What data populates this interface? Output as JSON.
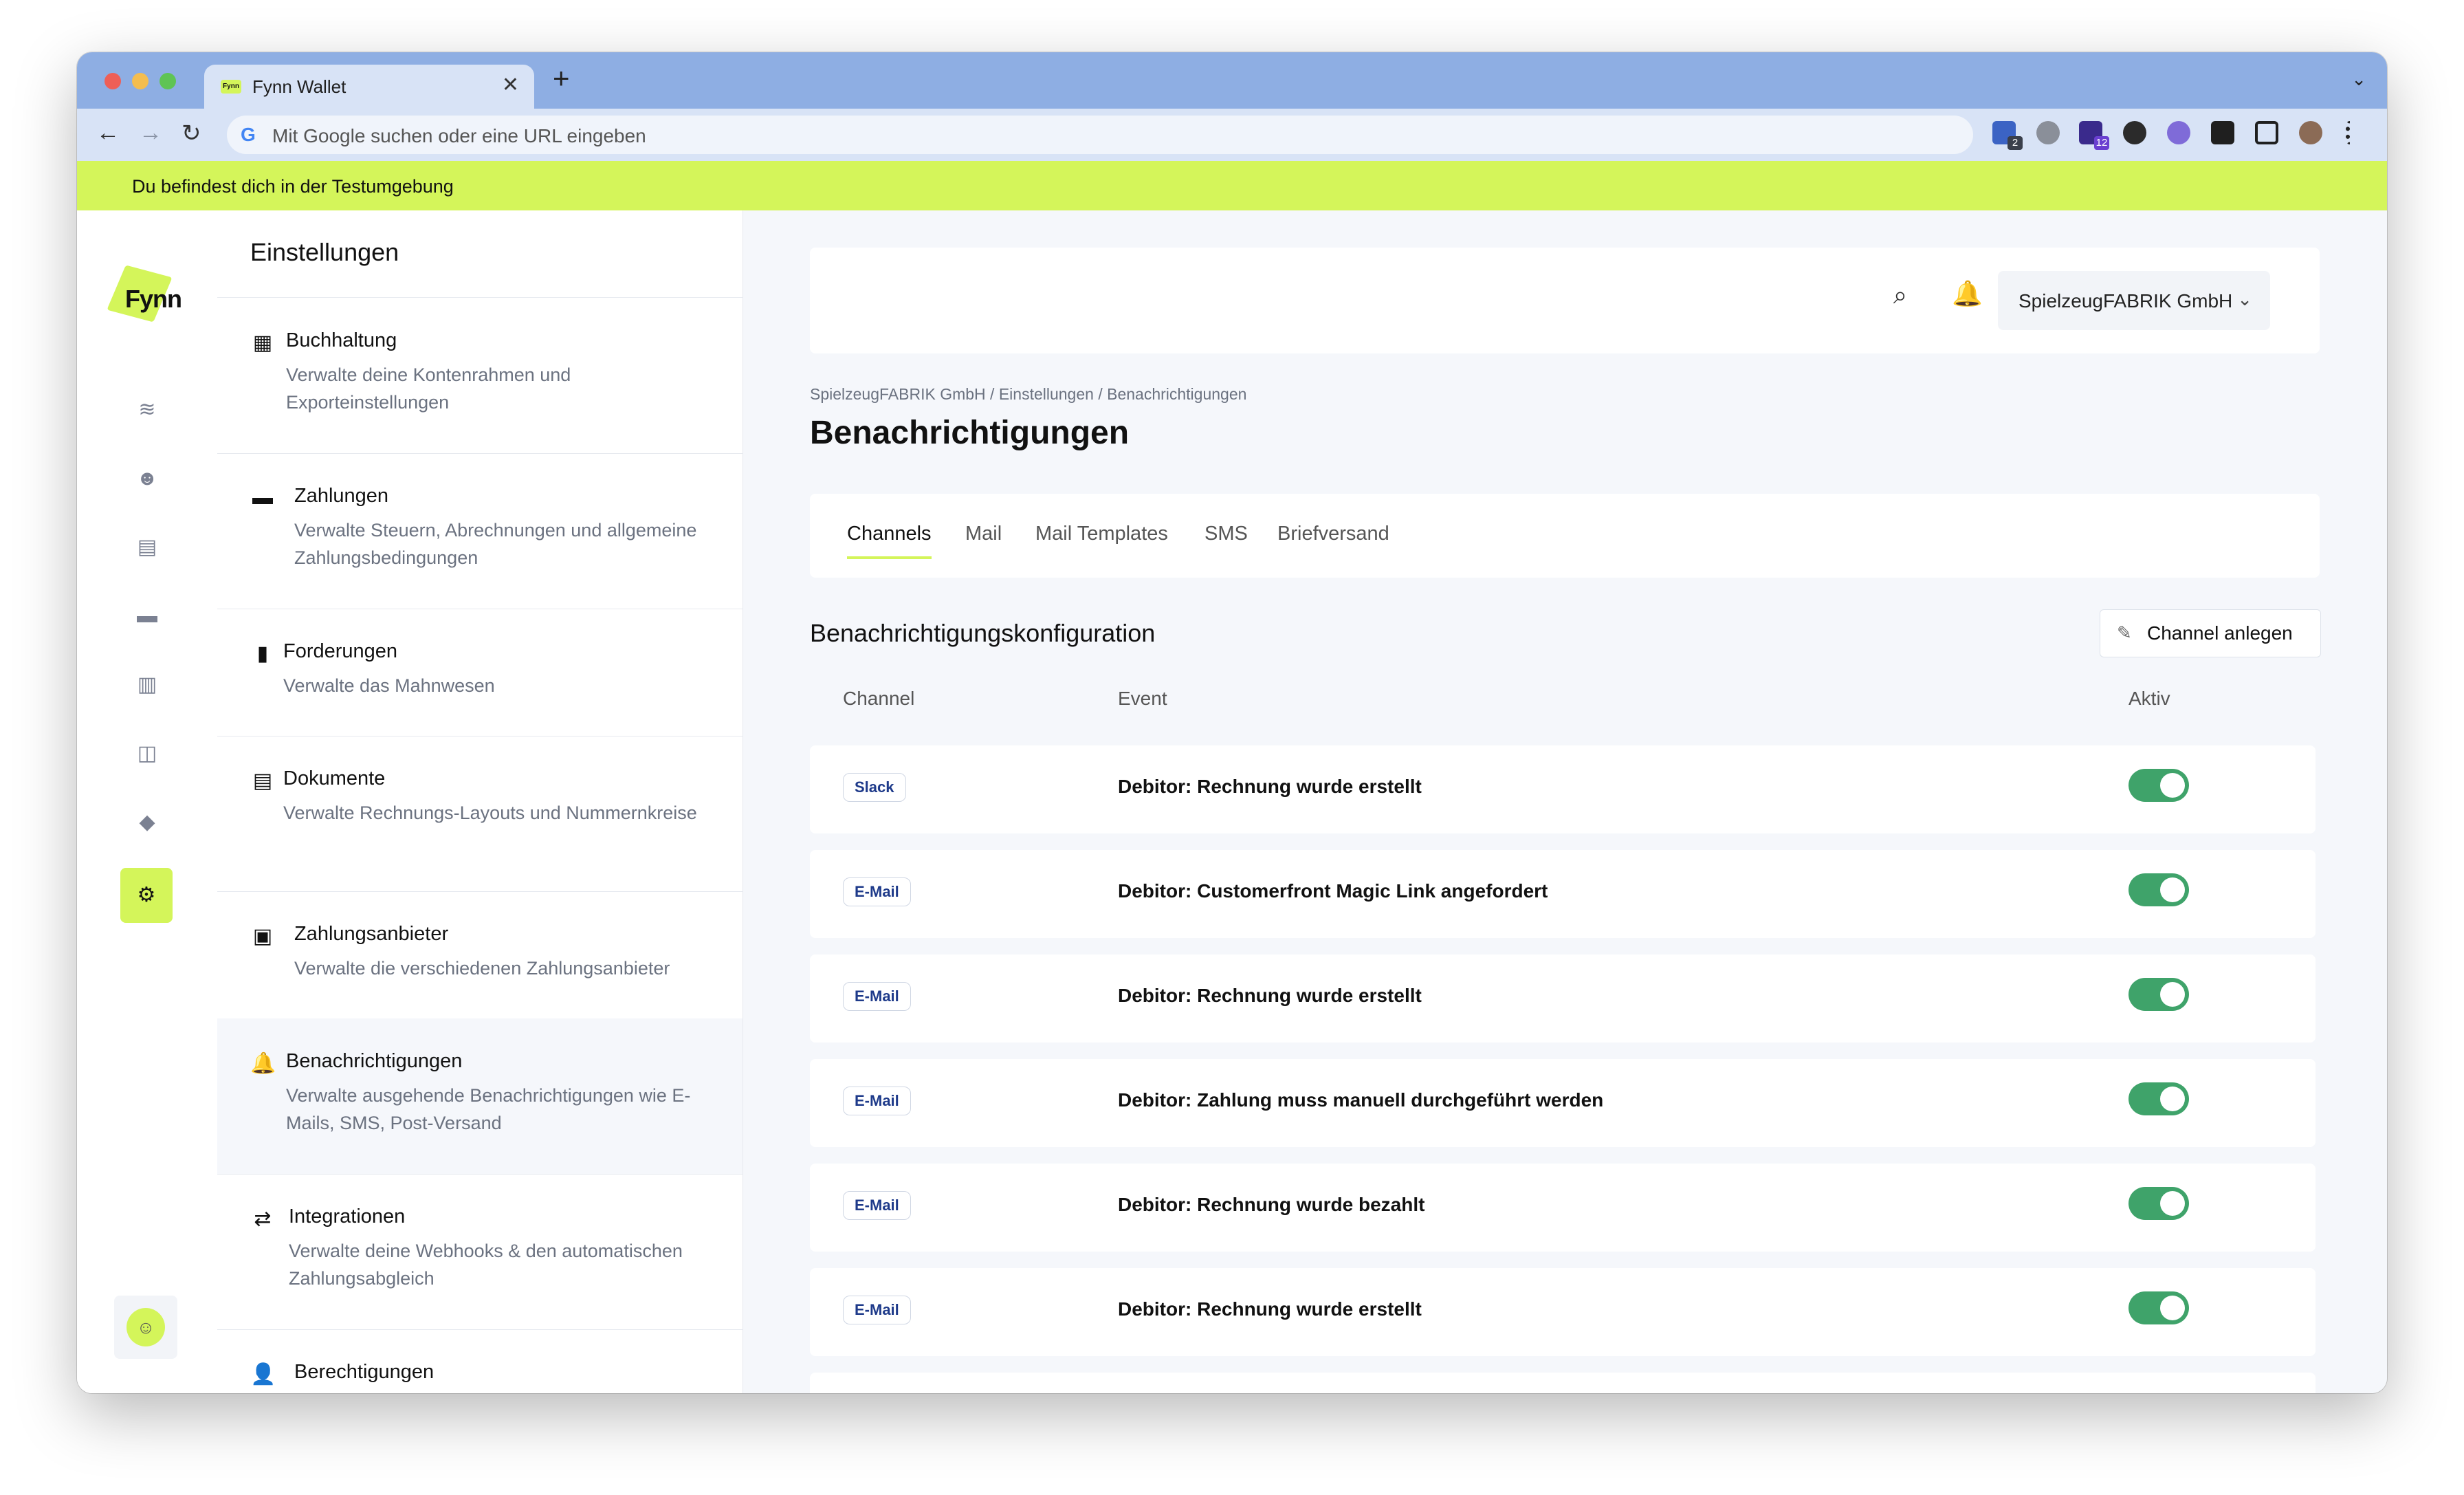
{
  "browser": {
    "tab_title": "Fynn Wallet",
    "tab_favicon": "Fynn",
    "close_glyph": "✕",
    "new_tab_glyph": "+",
    "tab_menu_glyph": "⌄",
    "back_glyph": "←",
    "forward_glyph": "→",
    "reload_glyph": "↻",
    "address_placeholder": "Mit Google suchen oder eine URL eingeben",
    "google_glyph": "G",
    "extensions": [
      {
        "name": "bitwarden-extension-icon",
        "badge": "2"
      },
      {
        "name": "privacy-extension-icon",
        "badge": ""
      },
      {
        "name": "graduation-extension-icon",
        "badge": "12"
      },
      {
        "name": "eye-extension-icon",
        "badge": ""
      },
      {
        "name": "purple-extension-icon",
        "badge": ""
      },
      {
        "name": "puzzle-icon",
        "badge": ""
      },
      {
        "name": "sidepanel-icon",
        "badge": ""
      },
      {
        "name": "profile-avatar",
        "badge": ""
      },
      {
        "name": "menu-icon",
        "badge": ""
      }
    ]
  },
  "env_banner": "Du befindest dich in der Testumgebung",
  "logo": "Fynn",
  "settings": {
    "title": "Einstellungen",
    "items": [
      {
        "icon": "calculator-icon",
        "glyph": "▦",
        "title": "Buchhaltung",
        "desc": "Verwalte deine Kontenrahmen und Exporteinstellungen"
      },
      {
        "icon": "credit-card-icon",
        "glyph": "▬",
        "title": "Zahlungen",
        "desc": "Verwalte Steuern, Abrechnungen und allgemeine Zahlungsbedingungen"
      },
      {
        "icon": "invoice-icon",
        "glyph": "▮",
        "title": "Forderungen",
        "desc": "Verwalte das Mahnwesen"
      },
      {
        "icon": "document-icon",
        "glyph": "▤",
        "title": "Dokumente",
        "desc": "Verwalte Rechnungs-Layouts und Nummernkreise"
      },
      {
        "icon": "money-icon",
        "glyph": "▣",
        "title": "Zahlungsanbieter",
        "desc": "Verwalte die verschiedenen Zahlungsanbieter"
      },
      {
        "icon": "bell-icon",
        "glyph": "🔔",
        "title": "Benachrichtigungen",
        "desc": "Verwalte ausgehende Benachrichtigungen wie E-Mails, SMS, Post-Versand"
      },
      {
        "icon": "integration-icon",
        "glyph": "⇄",
        "title": "Integrationen",
        "desc": "Verwalte deine Webhooks & den automatischen Zahlungsabgleich"
      },
      {
        "icon": "user-lock-icon",
        "glyph": "👤",
        "title": "Berechtigungen",
        "desc": ""
      }
    ]
  },
  "topbar": {
    "search_glyph": "⌕",
    "bell_glyph": "🔔",
    "company": "SpielzeugFABRIK GmbH",
    "chevron": "⌄"
  },
  "breadcrumb": "SpielzeugFABRIK GmbH / Einstellungen / Benachrichtigungen",
  "page_title": "Benachrichtigungen",
  "tabs": [
    {
      "label": "Channels",
      "active": true
    },
    {
      "label": "Mail",
      "active": false
    },
    {
      "label": "Mail Templates",
      "active": false
    },
    {
      "label": "SMS",
      "active": false
    },
    {
      "label": "Briefversand",
      "active": false
    }
  ],
  "section_title": "Benachrichtigungskonfiguration",
  "add_channel_button": {
    "icon": "✎",
    "label": "Channel anlegen"
  },
  "table": {
    "columns": [
      "Channel",
      "Event",
      "Aktiv"
    ],
    "rows": [
      {
        "channel": "Slack",
        "event": "Debitor: Rechnung wurde erstellt",
        "active": true
      },
      {
        "channel": "E-Mail",
        "event": "Debitor: Customerfront Magic Link angefordert",
        "active": true
      },
      {
        "channel": "E-Mail",
        "event": "Debitor: Rechnung wurde erstellt",
        "active": true
      },
      {
        "channel": "E-Mail",
        "event": "Debitor: Zahlung muss manuell durchgeführt werden",
        "active": true
      },
      {
        "channel": "E-Mail",
        "event": "Debitor: Rechnung wurde bezahlt",
        "active": true
      },
      {
        "channel": "E-Mail",
        "event": "Debitor: Rechnung wurde erstellt",
        "active": true
      }
    ]
  },
  "colors": {
    "accent": "#d4f55a",
    "toggle_on": "#3fa36a",
    "browser_chrome": "#8eaee3"
  }
}
